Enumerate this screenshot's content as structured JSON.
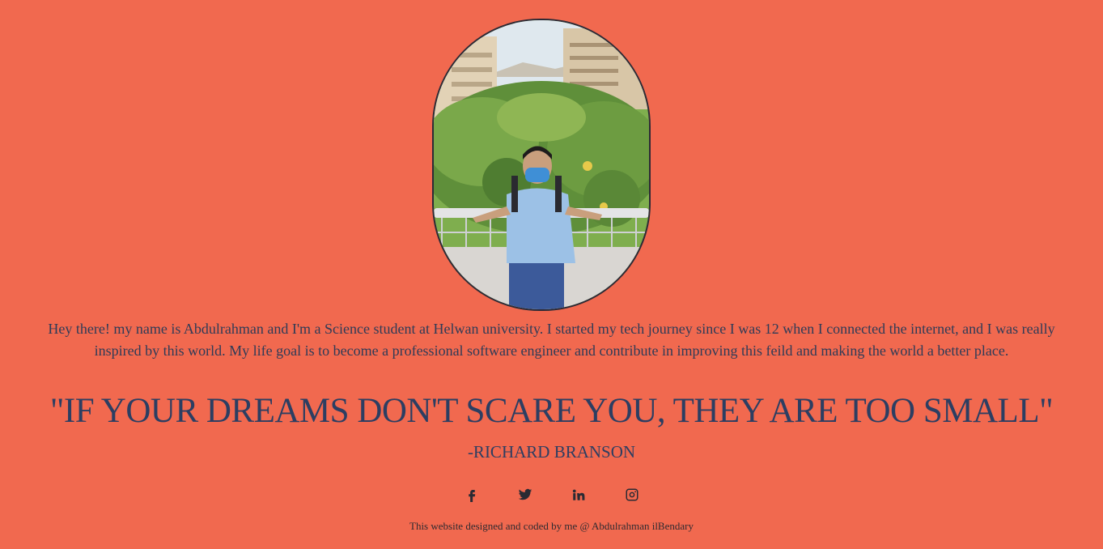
{
  "profile": {
    "photo_alt": "Profile photo"
  },
  "bio": {
    "text": "Hey there! my name is Abdulrahman and I'm a Science student at Helwan university. I started my tech journey since I was 12 when I connected the internet, and I was really inspired by this world. My life goal is to become a professional software engineer and contribute in improving this feild and making the world a better place."
  },
  "quote": {
    "text": "\"IF YOUR DREAMS DON'T SCARE YOU, THEY ARE TOO SMALL\"",
    "author": "-RICHARD BRANSON"
  },
  "social": [
    {
      "name": "facebook",
      "icon": "facebook-icon"
    },
    {
      "name": "twitter",
      "icon": "twitter-icon"
    },
    {
      "name": "linkedin",
      "icon": "linkedin-icon"
    },
    {
      "name": "instagram",
      "icon": "instagram-icon"
    }
  ],
  "footer": {
    "text": "This website designed and coded by me @ Abdulrahman ilBendary"
  },
  "colors": {
    "background": "#f1694f",
    "text": "#2c3e62"
  }
}
